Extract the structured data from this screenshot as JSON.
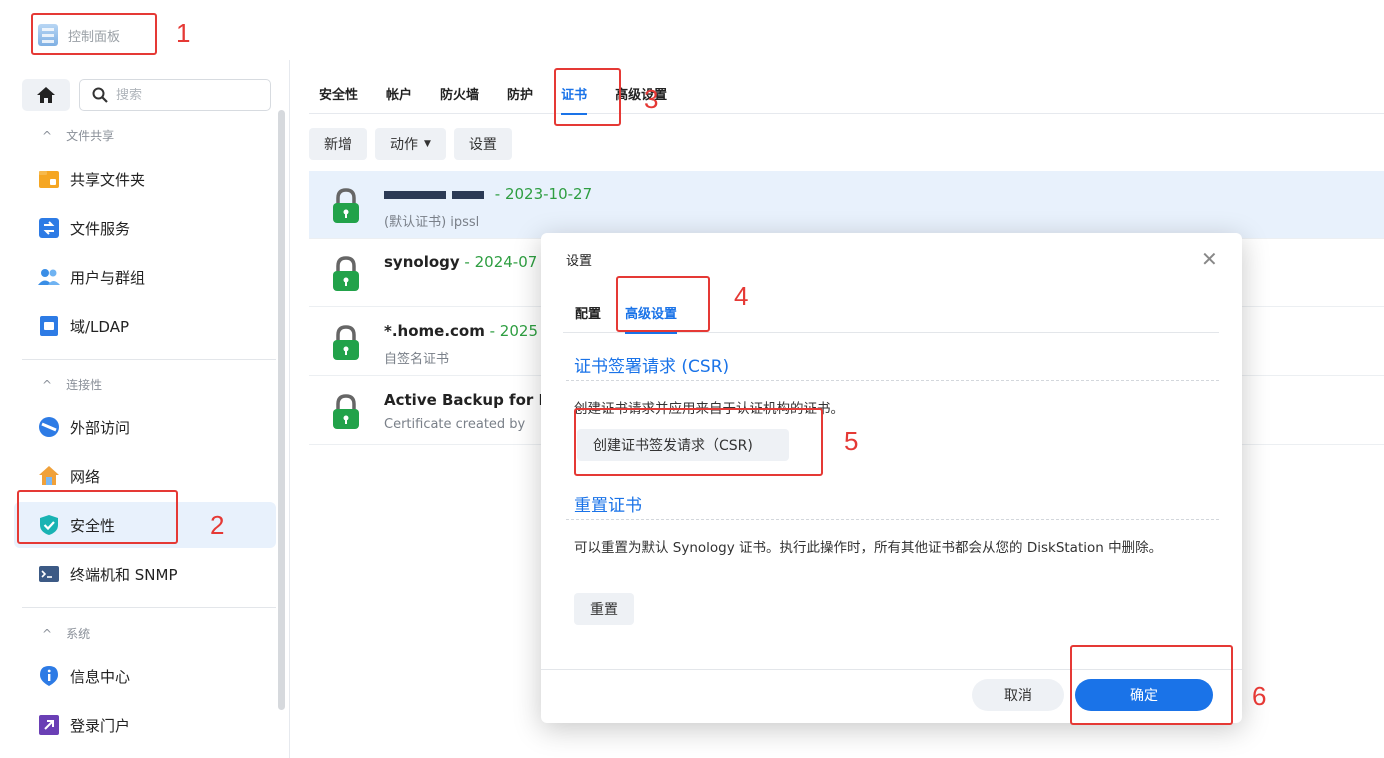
{
  "app": {
    "title": "控制面板",
    "icon": "control-panel-icon"
  },
  "sidebar": {
    "search": {
      "placeholder": "搜索"
    },
    "sections": [
      {
        "label": "文件共享",
        "items": [
          {
            "label": "共享文件夹",
            "icon": "shared-folder-icon"
          },
          {
            "label": "文件服务",
            "icon": "file-services-icon"
          },
          {
            "label": "用户与群组",
            "icon": "user-group-icon"
          },
          {
            "label": "域/LDAP",
            "icon": "domain-ldap-icon"
          }
        ]
      },
      {
        "label": "连接性",
        "items": [
          {
            "label": "外部访问",
            "icon": "external-access-icon"
          },
          {
            "label": "网络",
            "icon": "network-icon"
          },
          {
            "label": "安全性",
            "icon": "security-shield-icon",
            "active": true
          },
          {
            "label": "终端机和 SNMP",
            "icon": "terminal-icon"
          }
        ]
      },
      {
        "label": "系统",
        "items": [
          {
            "label": "信息中心",
            "icon": "info-center-icon"
          },
          {
            "label": "登录门户",
            "icon": "login-portal-icon"
          }
        ]
      }
    ]
  },
  "main": {
    "tabs": [
      "安全性",
      "帐户",
      "防火墙",
      "防护",
      "证书",
      "高级设置"
    ],
    "active_tab": "证书",
    "toolbar": {
      "add": "新增",
      "action": "动作",
      "settings": "设置"
    },
    "certificates": [
      {
        "name": "",
        "date": " - 2023-10-27",
        "sub": "(默认证书) ipssl",
        "redacted": true
      },
      {
        "name": "synology",
        "date": " - 2024-07",
        "sub": ""
      },
      {
        "name": "*.home.com",
        "date": " - 2025",
        "sub": "自签名证书"
      },
      {
        "name": "Active Backup for I",
        "date": "",
        "sub": "Certificate created by"
      }
    ]
  },
  "dialog": {
    "title": "设置",
    "tabs": [
      "配置",
      "高级设置"
    ],
    "active_tab": "高级设置",
    "csr_title": "证书签署请求 (CSR)",
    "csr_desc": "创建证书请求并应用来自于认证机构的证书。",
    "csr_button": "创建证书签发请求（CSR)",
    "reset_title": "重置证书",
    "reset_desc": "可以重置为默认 Synology 证书。执行此操作时，所有其他证书都会从您的 DiskStation 中删除。",
    "reset_button": "重置",
    "cancel": "取消",
    "ok": "确定"
  },
  "annotations": [
    "1",
    "2",
    "3",
    "4",
    "5",
    "6"
  ],
  "colors": {
    "accent": "#1a73e8",
    "annotation": "#e53935",
    "date_green": "#2e9e41"
  }
}
